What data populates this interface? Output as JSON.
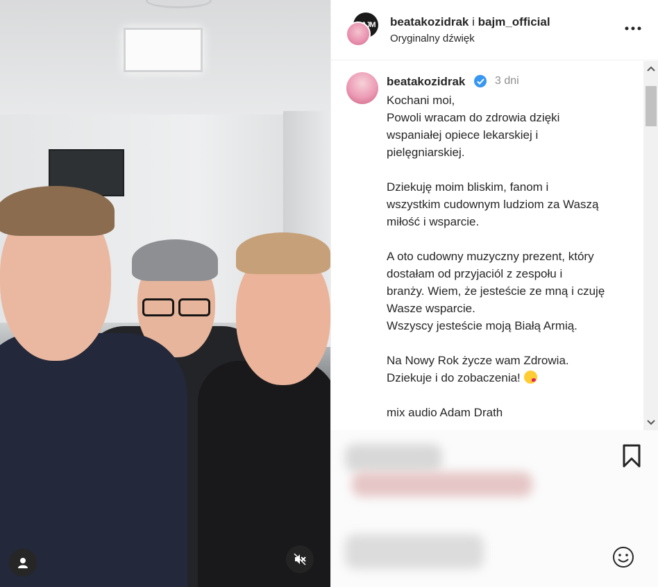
{
  "header": {
    "user1": "beatakozidrak",
    "separator": "i",
    "user2": "bajm_official",
    "audio_label": "Oryginalny dźwięk",
    "header_avatar_text": "BAJM"
  },
  "post": {
    "username": "beatakozidrak",
    "time": "3 dni",
    "lines": [
      "Kochani moi,",
      "Powoli wracam do zdrowia dzięki",
      "wspaniałej opiece lekarskiej i",
      "pielęgniarskiej.",
      "",
      "Dziekuję moim bliskim, fanom i",
      "wszystkim cudownym ludziom za Waszą",
      "miłość i wsparcie.",
      "",
      "A oto cudowny muzyczny prezent, który",
      "dostałam od przyjaciól z zespołu i",
      "branży. Wiem, że jesteście ze mną i czuję",
      "Wasze wsparcie.",
      "Wszyscy jesteście moją Białą Armią.",
      "",
      "Na Nowy Rok życze wam Zdrowia.",
      "Dziekuje i do zobaczenia!",
      "",
      "mix audio Adam Drath"
    ]
  },
  "icons": {
    "verified": "verified-badge-icon",
    "more": "more-options-icon",
    "bookmark": "bookmark-icon",
    "emoji": "emoji-icon",
    "mute": "muted-speaker-icon",
    "user": "user-avatar-icon"
  },
  "colors": {
    "verified": "#3897f0",
    "muted_text": "#8e8e8e",
    "text": "#262626"
  }
}
